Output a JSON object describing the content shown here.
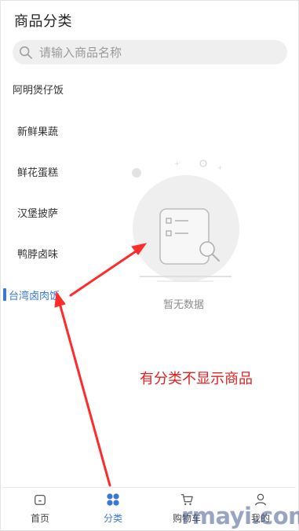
{
  "header": {
    "title": "商品分类"
  },
  "search": {
    "placeholder": "请输入商品名称"
  },
  "categories": [
    {
      "label": "阿明煲仔饭"
    },
    {
      "label": "新鲜果蔬"
    },
    {
      "label": "鲜花蛋糕"
    },
    {
      "label": "汉堡披萨"
    },
    {
      "label": "鸭脖卤味"
    },
    {
      "label": "台湾卤肉饭"
    }
  ],
  "empty_state": {
    "text": "暂无数据"
  },
  "annotation": {
    "text": "有分类不显示商品"
  },
  "tabs": [
    {
      "label": "首页",
      "icon": "home-icon"
    },
    {
      "label": "分类",
      "icon": "category-icon"
    },
    {
      "label": "购物车",
      "icon": "cart-icon"
    },
    {
      "label": "我的",
      "icon": "user-icon"
    }
  ],
  "watermark": "rmayi.com",
  "colors": {
    "accent": "#3a78d6",
    "annotation": "#e02020"
  }
}
